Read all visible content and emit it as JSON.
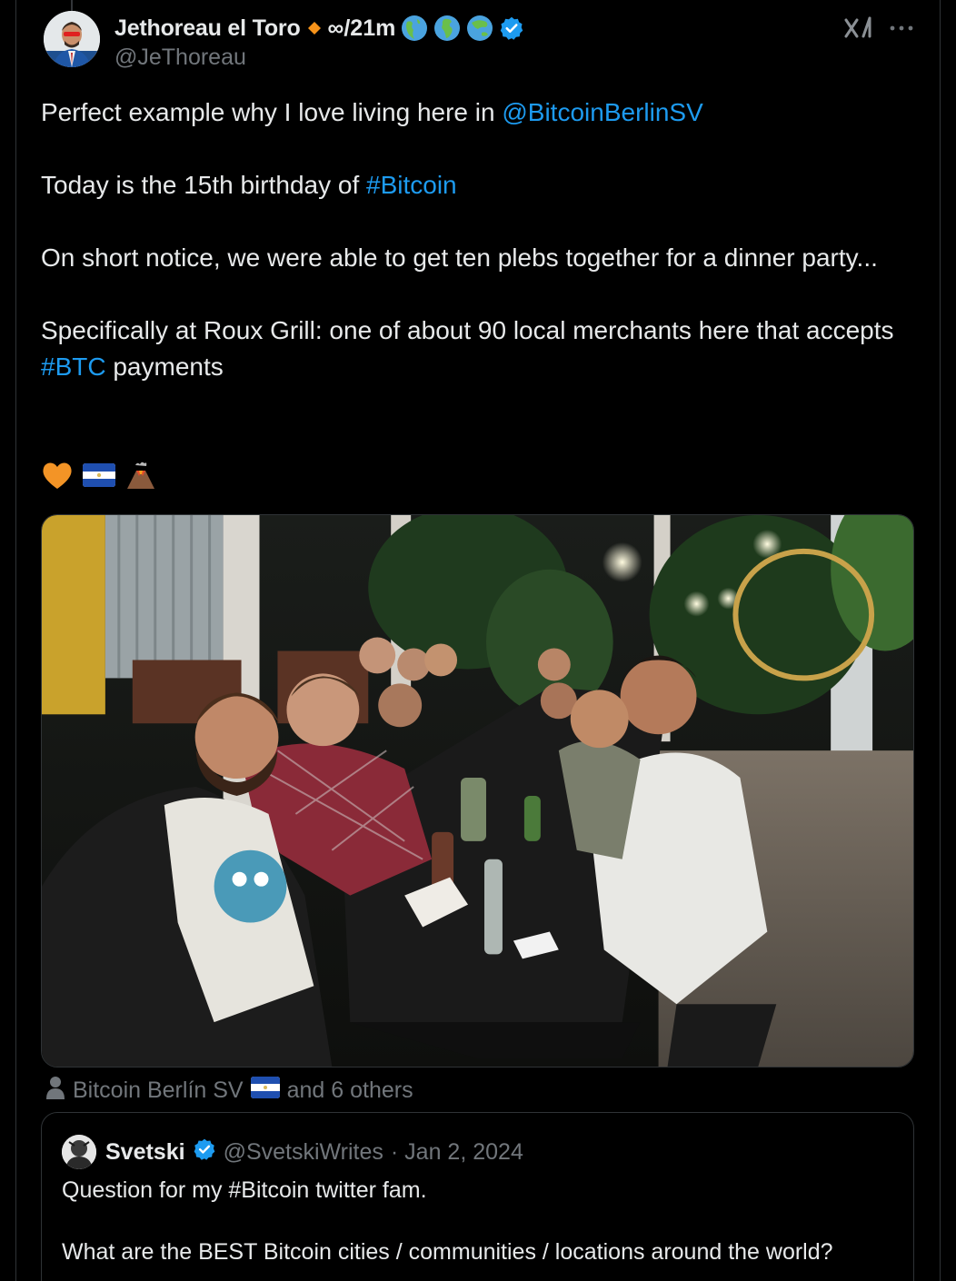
{
  "tweet": {
    "author": {
      "display_name": "Jethoreau el Toro",
      "name_suffix": "∞/21m",
      "handle": "@JeThoreau",
      "verified": true
    },
    "text": {
      "line1_prefix": "Perfect example why I love living here in ",
      "line1_mention": "@BitcoinBerlinSV",
      "line2_prefix": "Today is the 15th birthday of ",
      "line2_hashtag": "#Bitcoin",
      "line3": "On short notice, we were able to get ten plebs together for a dinner party...",
      "line4_prefix": "Specifically at Roux Grill: one of about 90 local merchants here that accepts ",
      "line4_hashtag": "#BTC",
      "line4_suffix": " payments"
    },
    "emojis": [
      "orange-heart",
      "el-salvador-flag",
      "volcano"
    ],
    "photo_description_icon": "photo",
    "tagged": {
      "first": "Bitcoin Berlín SV",
      "rest": "and 6 others"
    }
  },
  "quote": {
    "author": {
      "display_name": "Svetski",
      "handle": "@SvetskiWrites",
      "date": "· Jan 2, 2024",
      "verified": true
    },
    "line1": "Question for my #Bitcoin twitter fam.",
    "line2": "What are the BEST Bitcoin cities / communities / locations around the world?"
  },
  "colors": {
    "background": "#000000",
    "text": "#e7e9ea",
    "secondary": "#71767b",
    "link": "#1d9bf0",
    "border": "#2f3336",
    "verified": "#1d9bf0",
    "diamond": "#f7931a"
  }
}
